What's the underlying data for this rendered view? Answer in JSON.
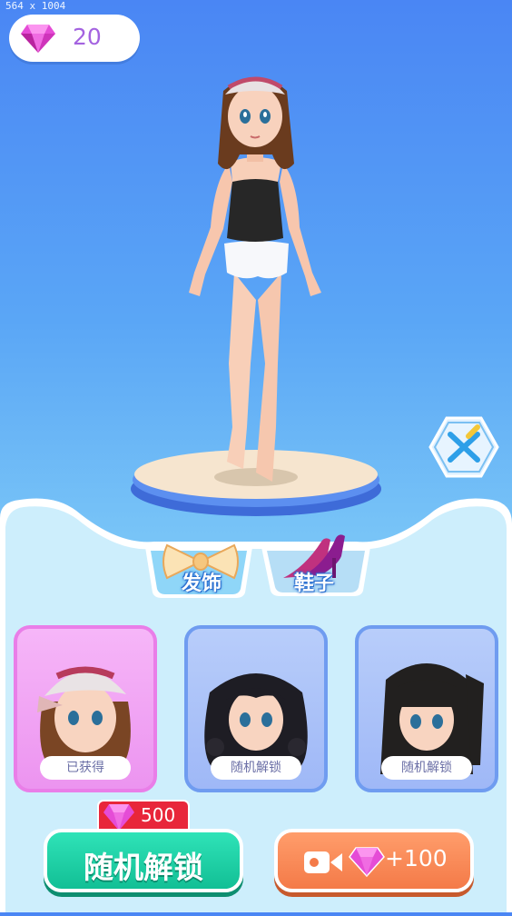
{
  "debug_label": "564 x 1004",
  "currency": {
    "icon": "gem-icon",
    "amount": "20"
  },
  "tabs": [
    {
      "label": "发饰",
      "icon": "bow-icon",
      "active": true
    },
    {
      "label": "鞋子",
      "icon": "high-heel-icon",
      "active": false
    }
  ],
  "items": [
    {
      "status": "已获得",
      "hair": "cap-wavy-brown",
      "selected": true
    },
    {
      "status": "随机解锁",
      "hair": "curly-black",
      "selected": false
    },
    {
      "status": "随机解锁",
      "hair": "straight-pigtail-black",
      "selected": false
    }
  ],
  "unlock": {
    "cost": "500",
    "label": "随机解锁"
  },
  "video_reward": {
    "label": "+100",
    "icon": "video-camera-icon"
  },
  "side_button": {
    "icon": "close-x-icon"
  },
  "colors": {
    "accent_pink": "#a463e0",
    "green": "#12bf95",
    "orange": "#f47a48",
    "panel": "#cdeefc"
  }
}
